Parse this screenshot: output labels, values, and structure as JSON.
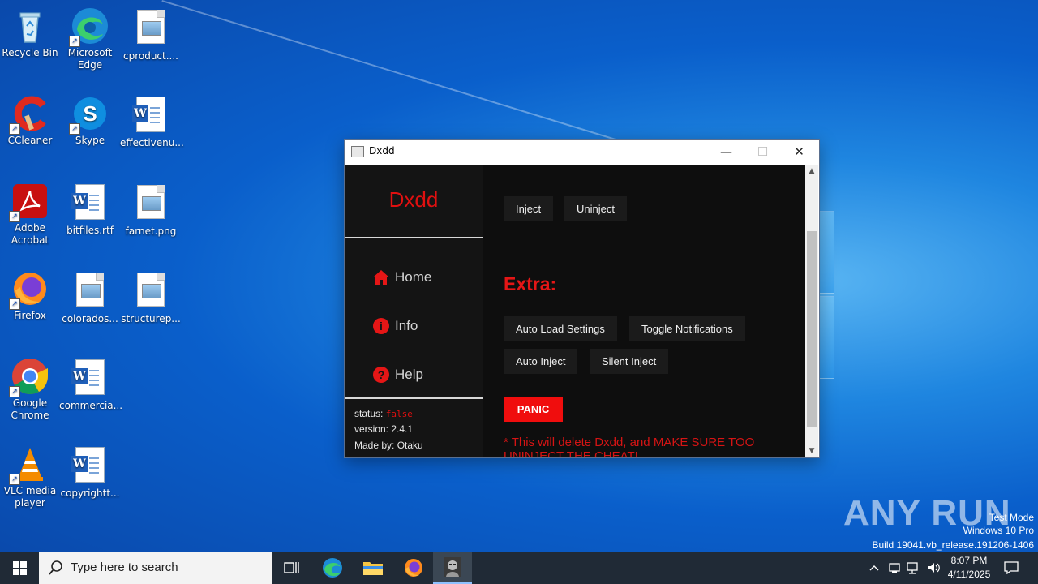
{
  "desktop": {
    "icons": [
      {
        "label": "Recycle Bin",
        "icon": "recycle-bin-icon"
      },
      {
        "label": "Microsoft Edge",
        "icon": "edge-icon"
      },
      {
        "label": "cproduct....",
        "icon": "image-file-icon"
      },
      {
        "label": "CCleaner",
        "icon": "ccleaner-icon"
      },
      {
        "label": "Skype",
        "icon": "skype-icon"
      },
      {
        "label": "effectivenu...",
        "icon": "word-file-icon"
      },
      {
        "label": "Adobe Acrobat",
        "icon": "acrobat-icon"
      },
      {
        "label": "bitfiles.rtf",
        "icon": "word-file-icon"
      },
      {
        "label": "farnet.png",
        "icon": "image-file-icon"
      },
      {
        "label": "Firefox",
        "icon": "firefox-icon"
      },
      {
        "label": "colorados...",
        "icon": "image-file-icon"
      },
      {
        "label": "structurep...",
        "icon": "image-file-icon"
      },
      {
        "label": "Google Chrome",
        "icon": "chrome-icon"
      },
      {
        "label": "commercia...",
        "icon": "word-file-icon"
      },
      {
        "label": "VLC media player",
        "icon": "vlc-icon"
      },
      {
        "label": "copyrightt...",
        "icon": "word-file-icon"
      }
    ]
  },
  "window": {
    "title": "Dxdd",
    "minimize_glyph": "—",
    "maximize_glyph": "☐",
    "close_glyph": "✕"
  },
  "app": {
    "brand": "Dxdd",
    "nav": [
      {
        "label": "Home",
        "icon": "home-icon"
      },
      {
        "label": "Info",
        "icon": "info-icon"
      },
      {
        "label": "Help",
        "icon": "help-icon"
      }
    ],
    "status_label": "status:",
    "status_value": "false",
    "version": "version: 2.4.1",
    "made_by": "Made by: Otaku",
    "buttons": {
      "inject": "Inject",
      "uninject": "Uninject",
      "auto_load_settings": "Auto Load Settings",
      "toggle_notifications": "Toggle Notifications",
      "auto_inject": "Auto Inject",
      "silent_inject": "Silent Inject",
      "panic": "PANIC"
    },
    "extra_heading": "Extra:",
    "warning": "* This will delete Dxdd, and MAKE SURE TOO UNINJECT THE CHEAT!"
  },
  "watermark": {
    "brand": "ANY RUN",
    "mode": "Test Mode",
    "os": "Windows 10 Pro",
    "build": "Build 19041.vb_release.191206-1406"
  },
  "taskbar": {
    "search_placeholder": "Type here to search",
    "time": "8:07 PM",
    "date": "4/11/2025",
    "apps": [
      "task-view-icon",
      "edge-icon",
      "file-explorer-icon",
      "firefox-icon",
      "dxdd-app-icon"
    ]
  },
  "colors": {
    "accent_red": "#e51616",
    "app_bg": "#0e0e0e",
    "sidebar_bg": "#141414",
    "taskbar_bg": "#202a36"
  }
}
